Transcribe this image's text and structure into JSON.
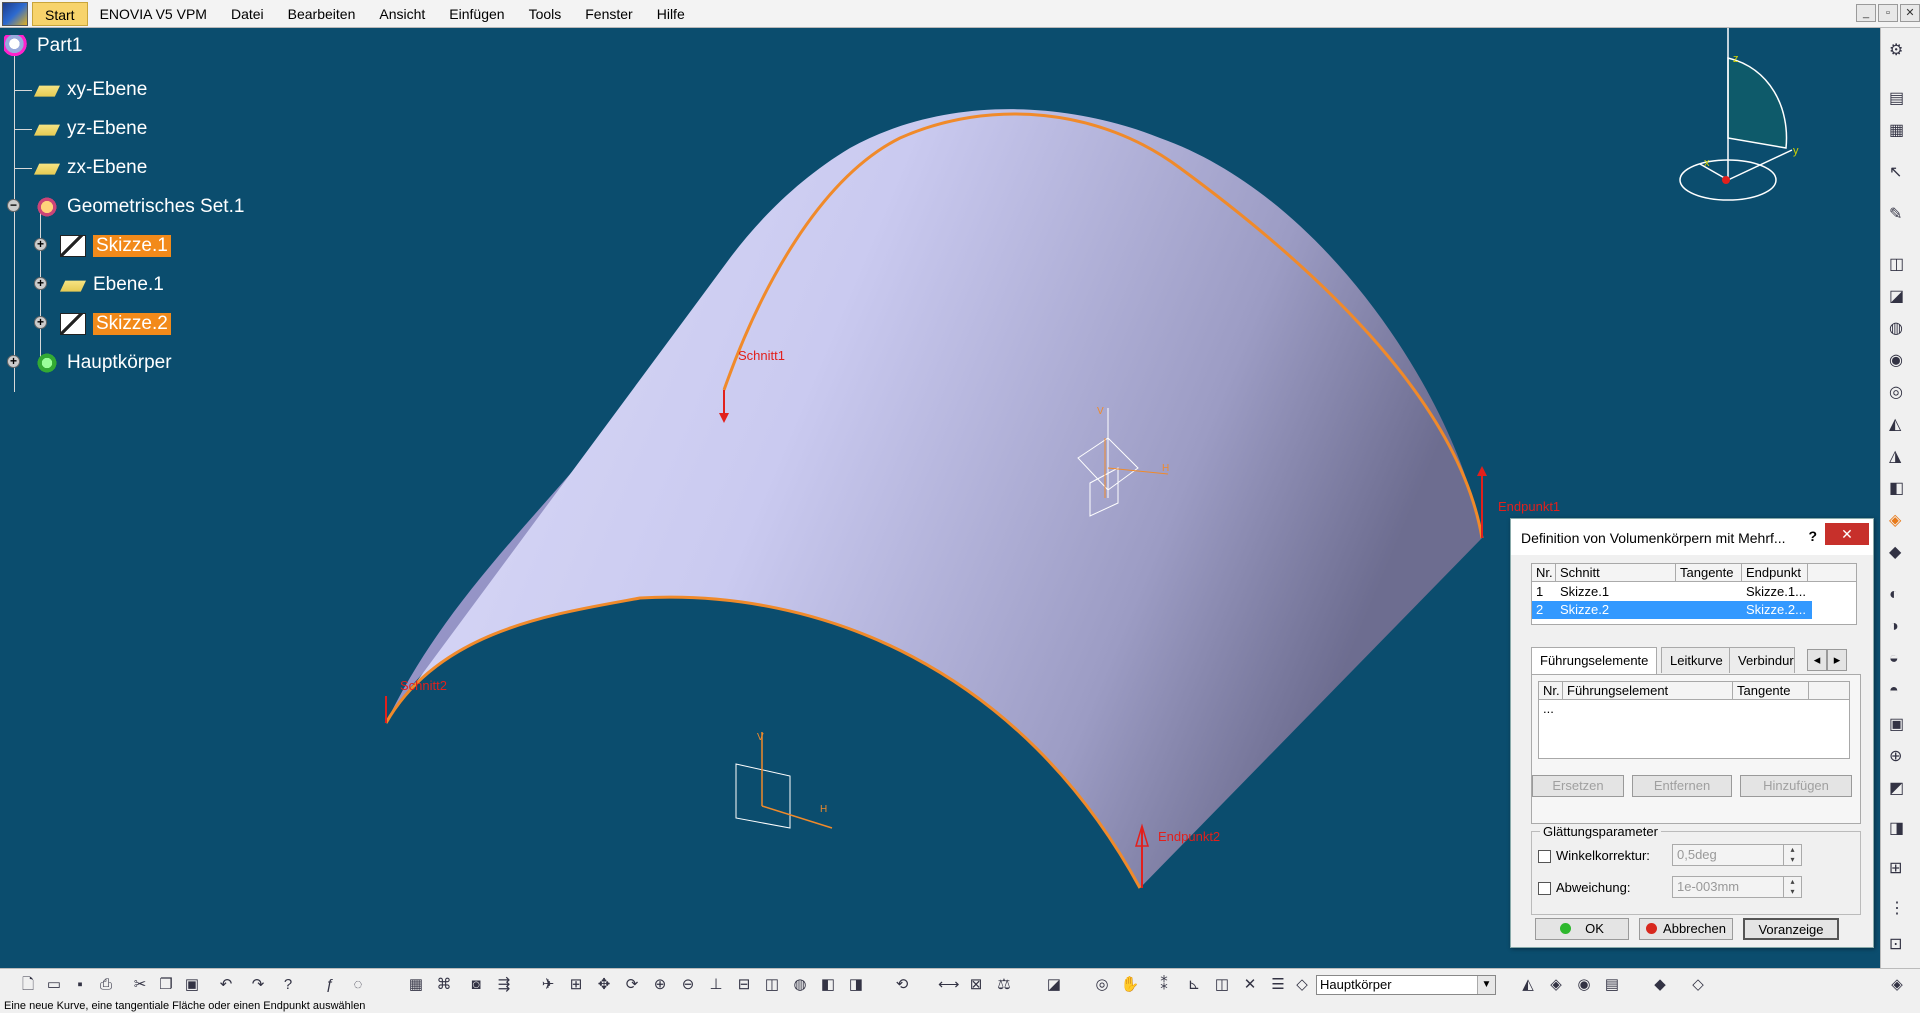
{
  "menubar": {
    "items": [
      "Start",
      "ENOVIA V5 VPM",
      "Datei",
      "Bearbeiten",
      "Ansicht",
      "Einfügen",
      "Tools",
      "Fenster",
      "Hilfe"
    ],
    "window_controls": [
      "_",
      "▫",
      "✕"
    ]
  },
  "tree": {
    "root": "Part1",
    "planes": [
      "xy-Ebene",
      "yz-Ebene",
      "zx-Ebene"
    ],
    "set": "Geometrisches Set.1",
    "set_children": [
      "Skizze.1",
      "Ebene.1",
      "Skizze.2"
    ],
    "body": "Hauptkörper"
  },
  "scene": {
    "labels": {
      "schnitt1": "Schnitt1",
      "schnitt2": "Schnitt2",
      "endpunkt1": "Endpunkt1",
      "endpunkt2": "Endpunkt2"
    },
    "axis_labels": {
      "v": "V",
      "h": "H",
      "x": "x",
      "y": "y",
      "z": "z"
    }
  },
  "dialog": {
    "title": "Definition von Volumenkörpern mit Mehrf...",
    "help": "?",
    "close": "✕",
    "sections_table": {
      "headers": [
        "Nr.",
        "Schnitt",
        "Tangente",
        "Endpunkt"
      ],
      "rows": [
        {
          "nr": "1",
          "schnitt": "Skizze.1",
          "tangente": "",
          "endpunkt": "Skizze.1..."
        },
        {
          "nr": "2",
          "schnitt": "Skizze.2",
          "tangente": "",
          "endpunkt": "Skizze.2..."
        }
      ]
    },
    "tabs": [
      "Führungselemente",
      "Leitkurve",
      "Verbindur"
    ],
    "guides_table": {
      "headers": [
        "Nr.",
        "Führungselement",
        "Tangente"
      ],
      "rows": [
        "..."
      ]
    },
    "action_buttons": [
      "Ersetzen",
      "Entfernen",
      "Hinzufügen"
    ],
    "smoothing": {
      "group_label": "Glättungsparameter",
      "angle_label": "Winkelkorrektur:",
      "angle_value": "0,5deg",
      "deviation_label": "Abweichung:",
      "deviation_value": "1e-003mm"
    },
    "footer": {
      "ok": "OK",
      "cancel": "Abbrechen",
      "preview": "Vorанzeige"
    }
  },
  "bottom_toolbar": {
    "current_body": "Hauptkörper"
  },
  "statusbar": {
    "text": "Eine neue Kurve, eine tangentiale Fläche oder einen Endpunkt auswählen"
  },
  "colors": {
    "background": "#0b4d6e",
    "surface": "#c9c8ef",
    "edge": "#f08a2a",
    "selection": "#f28a1a",
    "label": "#e2201c"
  }
}
